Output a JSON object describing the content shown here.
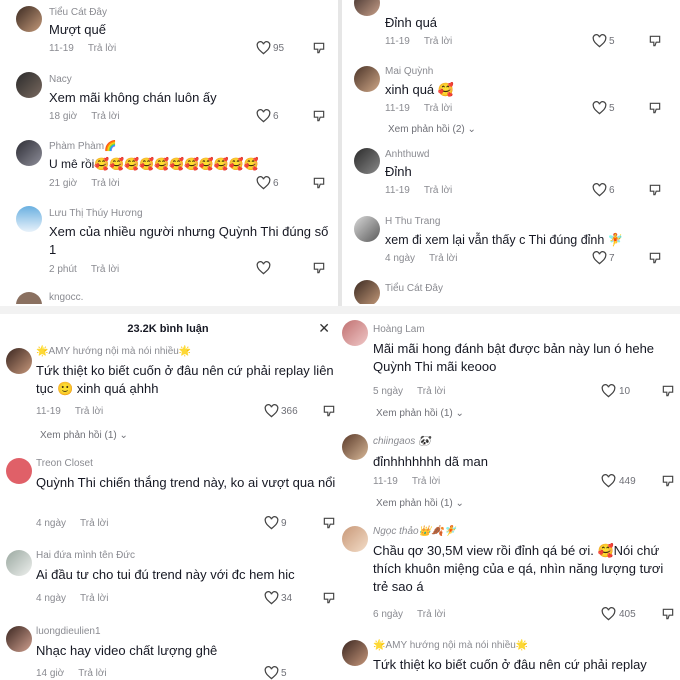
{
  "p1": {
    "comments": [
      {
        "name": "Tiểu Cát Đây",
        "text": "Mượt quế",
        "time": "11-19",
        "reply": "Trả lời",
        "likes": "95"
      },
      {
        "name": "Nacy",
        "text": "Xem mãi không chán luôn ấy",
        "time": "18 giờ",
        "reply": "Trả lời",
        "likes": "6"
      },
      {
        "name": "Phàm Phàm🌈",
        "text": "U mê rồi🥰🥰🥰🥰🥰🥰🥰🥰🥰🥰🥰",
        "time": "21 giờ",
        "reply": "Trả lời",
        "likes": "6"
      },
      {
        "name": "Lưu Thị Thúy Hương",
        "text": "Xem của nhiều người nhưng Quỳnh Thi đúng số 1",
        "time": "2 phút",
        "reply": "Trả lời",
        "likes": ""
      },
      {
        "name": "kngocc.",
        "text": "",
        "time": "",
        "reply": "",
        "likes": ""
      }
    ]
  },
  "p2": {
    "comments": [
      {
        "name": "",
        "text": "Đỉnh quá",
        "time": "11-19",
        "reply": "Trả lời",
        "likes": "5"
      },
      {
        "name": "Mai Quỳnh",
        "text": "xinh quá 🥰",
        "time": "11-19",
        "reply": "Trả lời",
        "likes": "5",
        "more": "Xem phản hồi (2)"
      },
      {
        "name": "Anhthuwd",
        "text": "Đỉnh",
        "time": "11-19",
        "reply": "Trả lời",
        "likes": "6"
      },
      {
        "name": "H Thu Trang",
        "text": "xem đi xem lại vẫn thấy c Thi đúng đỉnh 🧚",
        "time": "4 ngày",
        "reply": "Trả lời",
        "likes": "7"
      },
      {
        "name": "Tiểu Cát Đây",
        "text": "",
        "time": "",
        "reply": "",
        "likes": ""
      }
    ]
  },
  "p3": {
    "header": "23.2K bình luận",
    "close": "✕",
    "comments": [
      {
        "name": "🌟AMY hướng nội mà nói nhiều🌟",
        "text": "Tứk thiệt ko biết cuốn ở đâu nên cứ phải replay liên tục 🙂 xinh quá ạhhh",
        "time": "11-19",
        "reply": "Trả lời",
        "likes": "366",
        "more": "Xem phản hồi (1)"
      },
      {
        "name": "Treon Closet",
        "text": "Quỳnh Thi chiến thắng trend này, ko ai vượt qua nổi",
        "time": "4 ngày",
        "reply": "Trả lời",
        "likes": "9"
      },
      {
        "name": "Hai đứa mình tên Đức",
        "text": "Ai đầu tư cho tui đú trend này với đc hem hic",
        "time": "4 ngày",
        "reply": "Trả lời",
        "likes": "34"
      },
      {
        "name": "luongdieulien1",
        "text": "Nhạc hay video chất lượng ghê",
        "time": "14 giờ",
        "reply": "Trả lời",
        "likes": "5"
      }
    ]
  },
  "p4": {
    "comments": [
      {
        "name": "Hoàng Lam",
        "text": "Mãi mãi hong đánh bật được bản này lun ó hehe Quỳnh Thi mãi keooo",
        "time": "5 ngày",
        "reply": "Trả lời",
        "likes": "10",
        "more": "Xem phản hồi (1)"
      },
      {
        "name": "chiingaos 🐼",
        "text": "đỉnhhhhhhh dã man",
        "time": "11-19",
        "reply": "Trả lời",
        "likes": "449",
        "more": "Xem phản hồi (1)"
      },
      {
        "name": "Ngọc thảo👑🍂🧚",
        "text": "Chầu qơ 30,5M view rồi đỉnh qá bé ơi. 🥰Nói chứ thích khuôn miệng của e qá, nhìn năng lượng tươi trẻ sao á",
        "time": "6 ngày",
        "reply": "Trả lời",
        "likes": "405"
      },
      {
        "name": "🌟AMY hướng nội mà nói nhiều🌟",
        "text": "Tứk thiệt ko biết cuốn ở đâu nên cứ phải replay",
        "time": "",
        "reply": "",
        "likes": ""
      }
    ]
  },
  "colors": {
    "text": "#161823",
    "muted": "#8a8b91",
    "accent": "#fe2c55"
  }
}
